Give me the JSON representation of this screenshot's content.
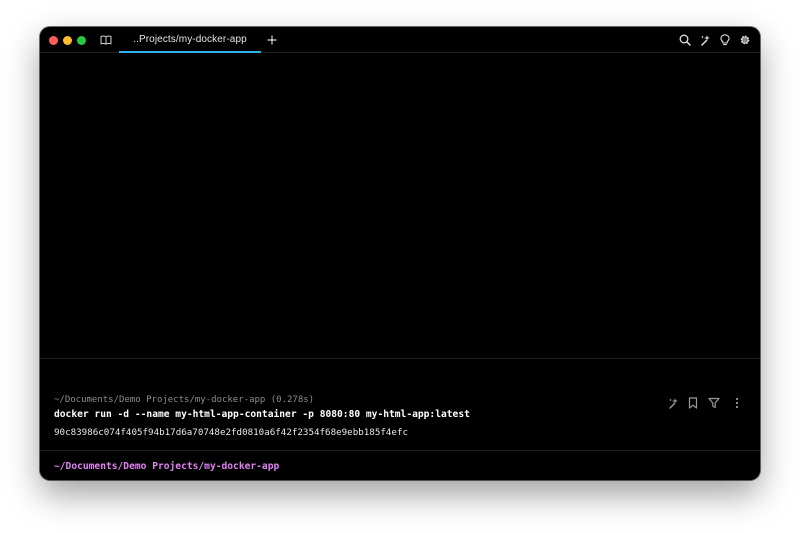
{
  "window": {
    "tab": {
      "label": "..Projects/my-docker-app",
      "accent": "#2fb3ea"
    }
  },
  "titlebar": {
    "icons": [
      "book-icon",
      "new-tab-icon",
      "search-icon",
      "ai-sparkle-icon",
      "lightbulb-icon",
      "settings-gear-icon"
    ]
  },
  "terminal": {
    "block": {
      "meta": "~/Documents/Demo Projects/my-docker-app (0.278s)",
      "command": "docker run -d --name my-html-app-container -p 8080:80 my-html-app:latest",
      "output": "90c83986c074f405f94b17d6a70748e2fd0810a6f42f2354f68e9ebb185f4efc",
      "actions": [
        "ai-sparkle-icon",
        "bookmark-icon",
        "filter-icon",
        "more-vertical-icon"
      ]
    },
    "prompt": "~/Documents/Demo Projects/my-docker-app",
    "prompt_color": "#e083f2"
  }
}
